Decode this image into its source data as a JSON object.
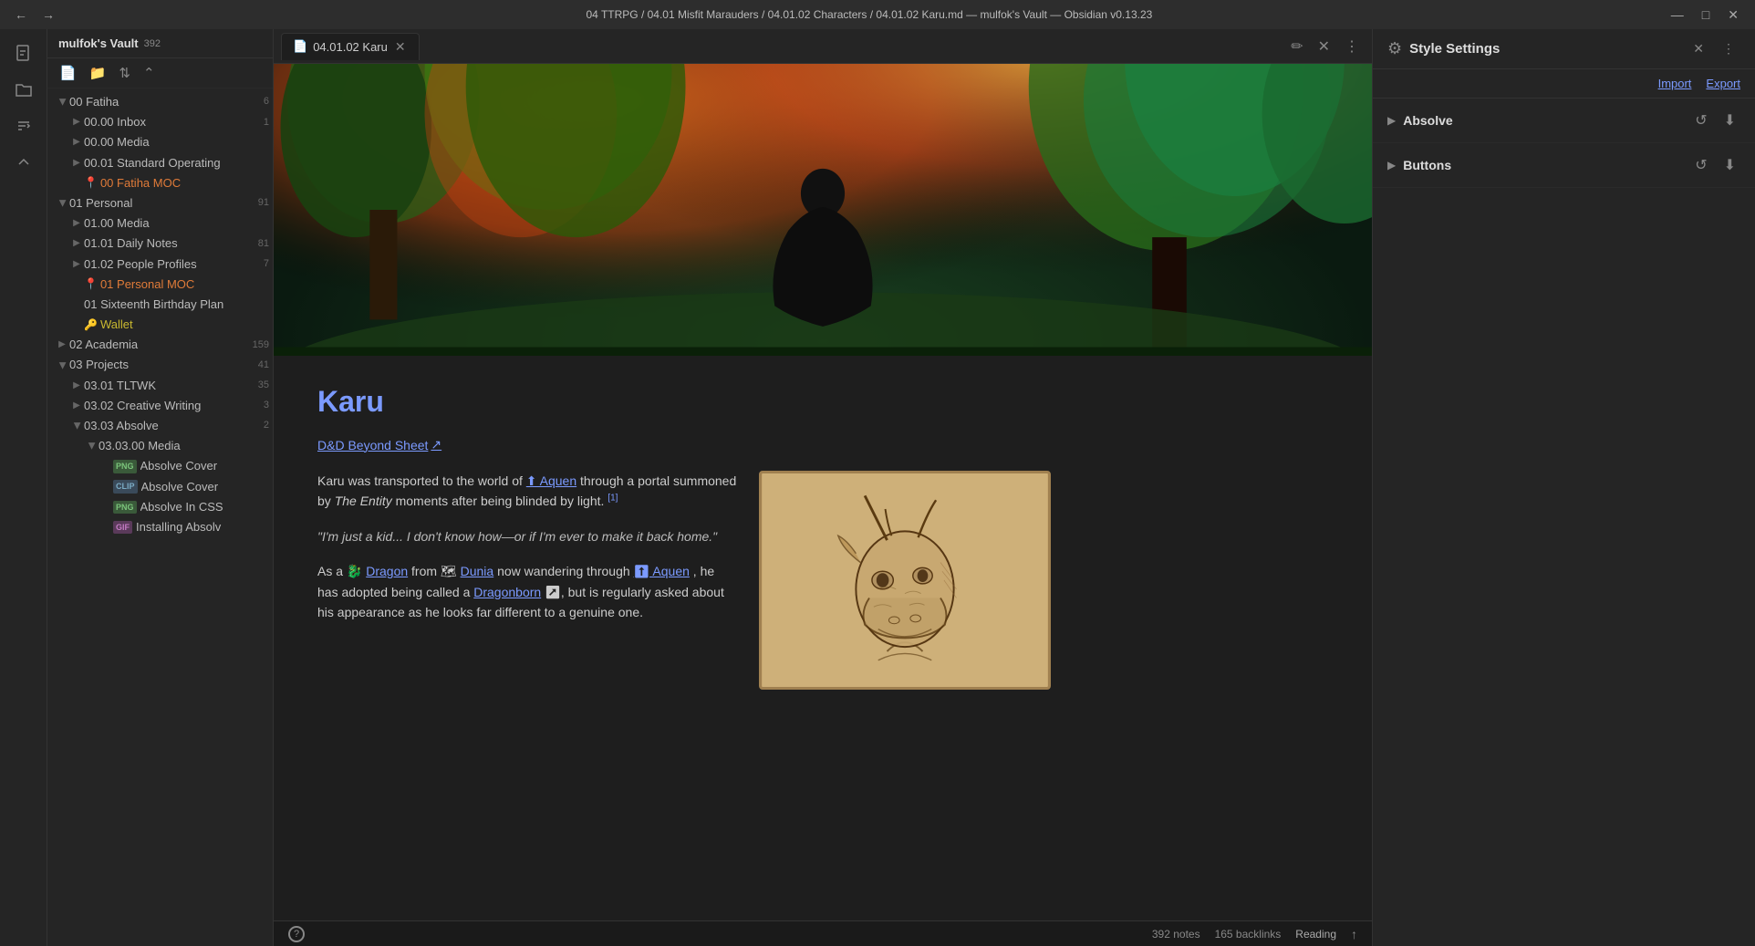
{
  "titleBar": {
    "backLabel": "←",
    "forwardLabel": "→",
    "title": "04 TTRPG / 04.01 Misfit Marauders / 04.01.02 Characters / 04.01.02 Karu.md — mulfok's Vault — Obsidian v0.13.23",
    "minimize": "—",
    "maximize": "□",
    "close": "✕"
  },
  "iconSidebar": {
    "items": [
      {
        "name": "new-file-icon",
        "symbol": "📄"
      },
      {
        "name": "open-folder-icon",
        "symbol": "📁"
      },
      {
        "name": "sort-icon",
        "symbol": "⇅"
      },
      {
        "name": "collapse-icon",
        "symbol": "⌃"
      }
    ]
  },
  "fileSidebar": {
    "vaultName": "mulfok's Vault",
    "vaultCount": "392",
    "toolbar": {
      "newNote": "📄",
      "newFolder": "📁",
      "sort": "⇅",
      "collapse": "⌃"
    },
    "tree": [
      {
        "id": "00-fatiha",
        "label": "00 Fatiha",
        "count": "6",
        "indent": 0,
        "type": "folder",
        "open": true,
        "arrow": true
      },
      {
        "id": "00-inbox",
        "label": "00.00 Inbox",
        "count": "1",
        "indent": 1,
        "type": "folder",
        "open": false,
        "arrow": true
      },
      {
        "id": "00-media",
        "label": "00.00 Media",
        "count": "",
        "indent": 1,
        "type": "folder",
        "open": false,
        "arrow": true
      },
      {
        "id": "00-standard",
        "label": "00.01 Standard Operating",
        "count": "",
        "indent": 1,
        "type": "folder",
        "open": false,
        "arrow": true
      },
      {
        "id": "00-moc",
        "label": "00 Fatiha MOC",
        "count": "",
        "indent": 1,
        "type": "pinned",
        "open": false,
        "arrow": false
      },
      {
        "id": "01-personal",
        "label": "01 Personal",
        "count": "91",
        "indent": 0,
        "type": "folder",
        "open": true,
        "arrow": true
      },
      {
        "id": "01-media",
        "label": "01.00 Media",
        "count": "",
        "indent": 1,
        "type": "folder",
        "open": false,
        "arrow": true
      },
      {
        "id": "01-daily",
        "label": "01.01 Daily Notes",
        "count": "81",
        "indent": 1,
        "type": "folder",
        "open": false,
        "arrow": true
      },
      {
        "id": "01-people",
        "label": "01.02 People Profiles",
        "count": "7",
        "indent": 1,
        "type": "folder",
        "open": false,
        "arrow": true
      },
      {
        "id": "01-personal-moc",
        "label": "01 Personal MOC",
        "count": "",
        "indent": 1,
        "type": "pinned",
        "open": false,
        "arrow": false
      },
      {
        "id": "01-birthday",
        "label": "01 Sixteenth Birthday Plan",
        "count": "",
        "indent": 1,
        "type": "file",
        "open": false,
        "arrow": false
      },
      {
        "id": "wallet",
        "label": "Wallet",
        "count": "",
        "indent": 1,
        "type": "wallet",
        "open": false,
        "arrow": false
      },
      {
        "id": "02-academia",
        "label": "02 Academia",
        "count": "159",
        "indent": 0,
        "type": "folder",
        "open": false,
        "arrow": true
      },
      {
        "id": "03-projects",
        "label": "03 Projects",
        "count": "41",
        "indent": 0,
        "type": "folder",
        "open": true,
        "arrow": true
      },
      {
        "id": "03-tltwk",
        "label": "03.01 TLTWK",
        "count": "35",
        "indent": 1,
        "type": "folder",
        "open": false,
        "arrow": true
      },
      {
        "id": "03-creative",
        "label": "03.02 Creative Writing",
        "count": "3",
        "indent": 1,
        "type": "folder",
        "open": false,
        "arrow": true
      },
      {
        "id": "03-absolve",
        "label": "03.03 Absolve",
        "count": "2",
        "indent": 1,
        "type": "folder",
        "open": true,
        "arrow": true
      },
      {
        "id": "03-absolve-media",
        "label": "03.03.00 Media",
        "count": "",
        "indent": 2,
        "type": "folder",
        "open": true,
        "arrow": true
      },
      {
        "id": "absolve-cover-png",
        "label": "Absolve Cover",
        "count": "",
        "indent": 3,
        "type": "png",
        "open": false,
        "arrow": false
      },
      {
        "id": "absolve-cover-clip",
        "label": "Absolve Cover",
        "count": "",
        "indent": 3,
        "type": "clip",
        "open": false,
        "arrow": false
      },
      {
        "id": "absolve-in-css-png",
        "label": "Absolve In CSS",
        "count": "",
        "indent": 3,
        "type": "png",
        "open": false,
        "arrow": false
      },
      {
        "id": "installing-absolv-gif",
        "label": "Installing Absolv",
        "count": "",
        "indent": 3,
        "type": "gif",
        "open": false,
        "arrow": false
      }
    ]
  },
  "editorTab": {
    "icon": "📄",
    "title": "04.01.02 Karu",
    "editIcon": "✏",
    "closeIcon": "✕",
    "moreIcon": "⋮"
  },
  "noteContent": {
    "title": "Karu",
    "link": "D&D Beyond Sheet",
    "linkExternal": "↗",
    "body": {
      "para1start": "Karu was transported to the world of ",
      "aquenLink1": "⬆ Aquen",
      "para1mid": " through a portal summoned by ",
      "italic1": "The Entity",
      "para1end": " moments after being blinded by light.",
      "sup1": "[1]",
      "quote": "\"I'm just a kid... I don't know how—or if I'm ever to make it back home.\"",
      "para2start": "As a ",
      "dragonEmoji": "🐉",
      "dragonLink": "Dragon",
      "para2mid": " from ",
      "duniaEmoji": "🗺",
      "duniaLink": "Dunia",
      "para2end": " now wandering through ",
      "aquenLink2": "⬆ Aquen",
      "para2end2": ", he has adopted being called a ",
      "dragonbornLink": "Dragonborn",
      "para2end3": " ↗, but is regularly asked about his appearance as he looks far different to a genuine one."
    }
  },
  "rightPanel": {
    "gearIcon": "⚙",
    "title": "Style Settings",
    "closeIcon": "✕",
    "moreIcon": "⋮",
    "importLabel": "Import",
    "exportLabel": "Export",
    "sections": [
      {
        "name": "Absolve",
        "arrow": "▶",
        "resetIcon": "↺",
        "downloadIcon": "⬇"
      },
      {
        "name": "Buttons",
        "arrow": "▶",
        "resetIcon": "↺",
        "downloadIcon": "⬇"
      }
    ]
  },
  "statusBar": {
    "notesCount": "392 notes",
    "backlinksCount": "165 backlinks",
    "readingMode": "Reading",
    "helpIcon": "?",
    "syncIcon": "↑"
  }
}
